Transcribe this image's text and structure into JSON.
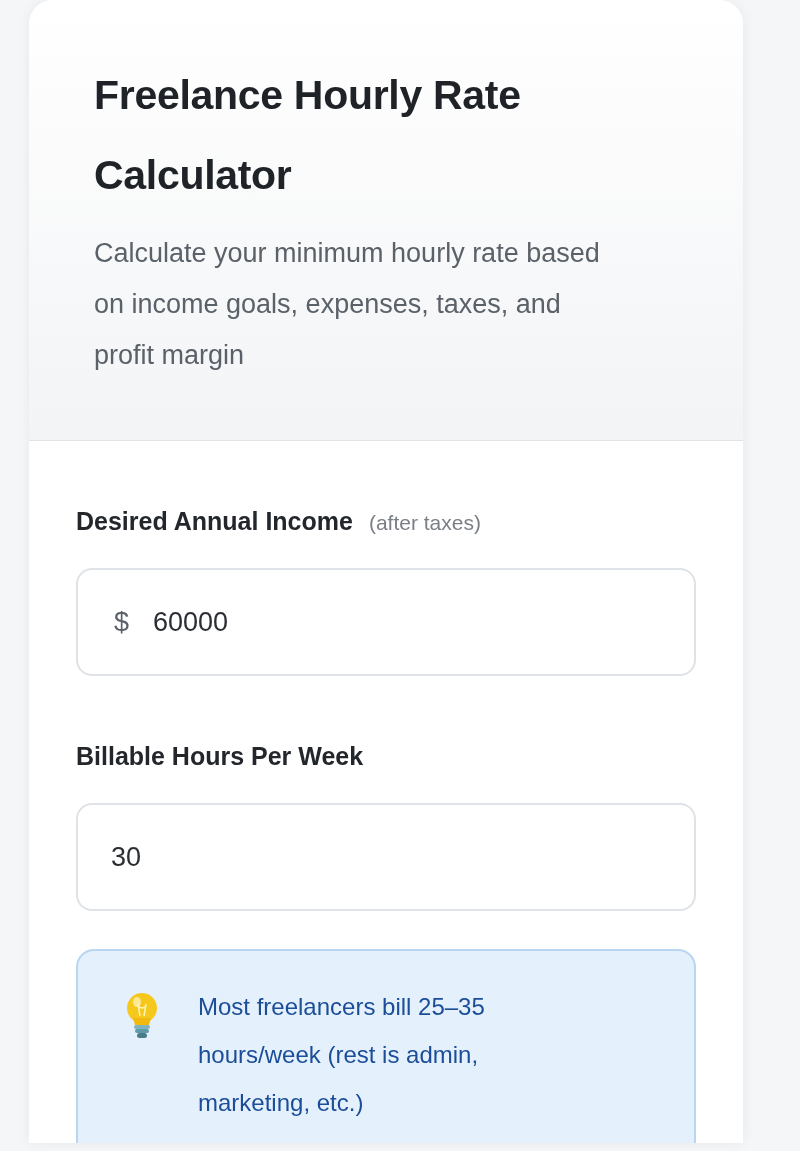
{
  "header": {
    "title": "Freelance Hourly Rate Calculator",
    "subtitle": "Calculate your minimum hourly rate based on income goals, expenses, taxes, and profit margin"
  },
  "fields": [
    {
      "label": "Desired Annual Income",
      "hint": "(after taxes)",
      "prefix": "$",
      "value": "60000"
    },
    {
      "label": "Billable Hours Per Week",
      "value": "30"
    }
  ],
  "tip": {
    "text": "Most freelancers bill 25–35 hours/week (rest is admin, marketing, etc.)"
  }
}
